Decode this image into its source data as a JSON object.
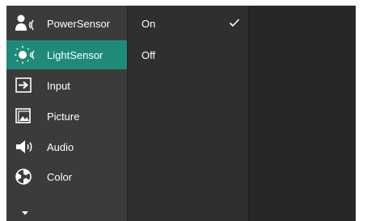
{
  "menu": {
    "items": [
      {
        "label": "PowerSensor",
        "icon": "power-sensor-icon"
      },
      {
        "label": "LightSensor",
        "icon": "light-sensor-icon"
      },
      {
        "label": "Input",
        "icon": "input-icon"
      },
      {
        "label": "Picture",
        "icon": "picture-icon"
      },
      {
        "label": "Audio",
        "icon": "audio-icon"
      },
      {
        "label": "Color",
        "icon": "color-icon"
      }
    ],
    "selected": "LightSensor",
    "scroll_icon": "chevron-down-icon"
  },
  "submenu": {
    "items": [
      {
        "label": "On",
        "checked": true
      },
      {
        "label": "Off",
        "checked": false
      }
    ]
  },
  "colors": {
    "menu_bg": "#3b3b3b",
    "submenu_bg": "#2f2f2f",
    "panel_bg": "#262626",
    "accent": "#1f8a78",
    "text": "#ffffff"
  }
}
